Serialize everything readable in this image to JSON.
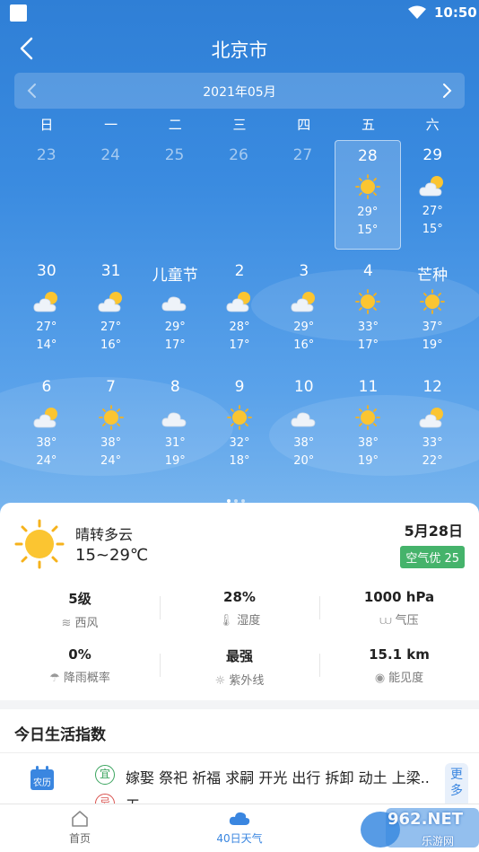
{
  "status_bar": {
    "time": "10:50"
  },
  "header": {
    "city": "北京市"
  },
  "calendar": {
    "month_label": "2021年05月",
    "weekdays": [
      "日",
      "一",
      "二",
      "三",
      "四",
      "五",
      "六"
    ],
    "rows": [
      [
        {
          "day": "23",
          "muted": true
        },
        {
          "day": "24",
          "muted": true
        },
        {
          "day": "25",
          "muted": true
        },
        {
          "day": "26",
          "muted": true
        },
        {
          "day": "27",
          "muted": true
        },
        {
          "day": "28",
          "icon": "sun",
          "hi": "29°",
          "lo": "15°",
          "selected": true
        },
        {
          "day": "29",
          "icon": "partly-cloudy",
          "hi": "27°",
          "lo": "15°"
        }
      ],
      [
        {
          "day": "30",
          "icon": "partly-cloudy",
          "hi": "27°",
          "lo": "14°"
        },
        {
          "day": "31",
          "icon": "partly-cloudy",
          "hi": "27°",
          "lo": "16°"
        },
        {
          "day": "儿童节",
          "icon": "cloudy",
          "hi": "29°",
          "lo": "17°"
        },
        {
          "day": "2",
          "icon": "partly-cloudy",
          "hi": "28°",
          "lo": "17°"
        },
        {
          "day": "3",
          "icon": "partly-cloudy",
          "hi": "29°",
          "lo": "16°"
        },
        {
          "day": "4",
          "icon": "sun",
          "hi": "33°",
          "lo": "17°"
        },
        {
          "day": "芒种",
          "icon": "sun",
          "hi": "37°",
          "lo": "19°"
        }
      ],
      [
        {
          "day": "6",
          "icon": "partly-cloudy",
          "hi": "38°",
          "lo": "24°"
        },
        {
          "day": "7",
          "icon": "sun",
          "hi": "38°",
          "lo": "24°"
        },
        {
          "day": "8",
          "icon": "cloudy",
          "hi": "31°",
          "lo": "19°"
        },
        {
          "day": "9",
          "icon": "sun",
          "hi": "32°",
          "lo": "18°"
        },
        {
          "day": "10",
          "icon": "cloudy",
          "hi": "38°",
          "lo": "20°"
        },
        {
          "day": "11",
          "icon": "sun",
          "hi": "38°",
          "lo": "19°"
        },
        {
          "day": "12",
          "icon": "partly-cloudy",
          "hi": "33°",
          "lo": "22°"
        }
      ]
    ]
  },
  "today": {
    "condition": "晴转多云",
    "temp_range": "15~29℃",
    "date": "5月28日",
    "aqi": "空气优 25",
    "stats": [
      {
        "value": "5级",
        "label": "西风",
        "icon": "wind-icon",
        "glyph": "≋"
      },
      {
        "value": "28%",
        "label": "湿度",
        "icon": "thermometer-icon",
        "glyph": "🌡"
      },
      {
        "value": "1000 hPa",
        "label": "气压",
        "icon": "pressure-icon",
        "glyph": "⩊"
      },
      {
        "value": "0%",
        "label": "降雨概率",
        "icon": "umbrella-icon",
        "glyph": "☂"
      },
      {
        "value": "最强",
        "label": "紫外线",
        "icon": "uv-sun-icon",
        "glyph": "☼"
      },
      {
        "value": "15.1 km",
        "label": "能见度",
        "icon": "eye-icon",
        "glyph": "◉"
      }
    ]
  },
  "life_index": {
    "title": "今日生活指数",
    "calendar_label": "农历",
    "yi_badge": "宜",
    "yi_text": "嫁娶 祭祀 祈福 求嗣 开光 出行 拆卸 动土 上梁...",
    "ji_badge": "忌",
    "ji_text": "无",
    "more": "更多"
  },
  "tabbar": {
    "home": "首页",
    "forty_day": "40日天气"
  },
  "watermark": {
    "text": "962.NET",
    "sub": "乐游网"
  }
}
